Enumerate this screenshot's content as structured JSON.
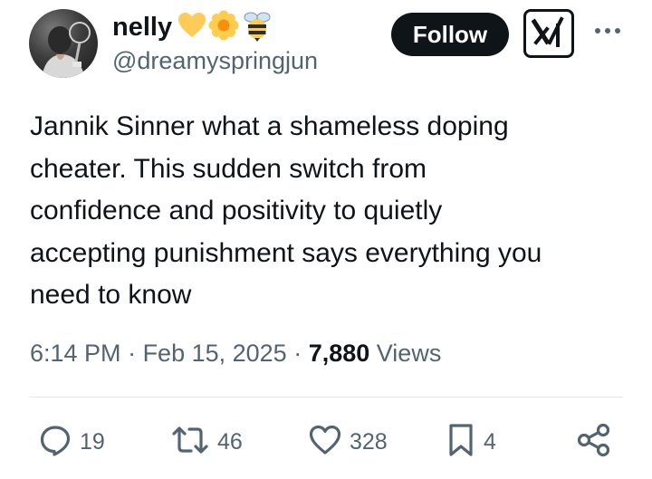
{
  "author": {
    "display_name": "nelly",
    "emojis": [
      "yellow-heart",
      "blossom",
      "honeybee"
    ],
    "handle": "@dreamyspringjun",
    "avatar": "avatar-photo"
  },
  "header": {
    "follow_label": "Follow",
    "grok_icon": "grok-icon",
    "more_icon": "more-icon"
  },
  "tweet": {
    "text": "Jannik Sinner what a shameless doping\ncheater. This sudden switch from\nconfidence and positivity to quietly\naccepting punishment says everything you\nneed to know"
  },
  "meta": {
    "time": "6:14 PM",
    "separator": " · ",
    "date": "Feb 15, 2025",
    "views_count": "7,880",
    "views_label": " Views"
  },
  "actions": {
    "replies": {
      "icon": "reply-icon",
      "count": "19"
    },
    "reposts": {
      "icon": "repost-icon",
      "count": "46"
    },
    "likes": {
      "icon": "heart-icon",
      "count": "328"
    },
    "bookmarks": {
      "icon": "bookmark-icon",
      "count": "4"
    },
    "share": {
      "icon": "share-icon"
    }
  },
  "colors": {
    "text_primary": "#0f1419",
    "text_secondary": "#536471",
    "divider": "#e6e9ec",
    "button_bg": "#0f1419"
  }
}
